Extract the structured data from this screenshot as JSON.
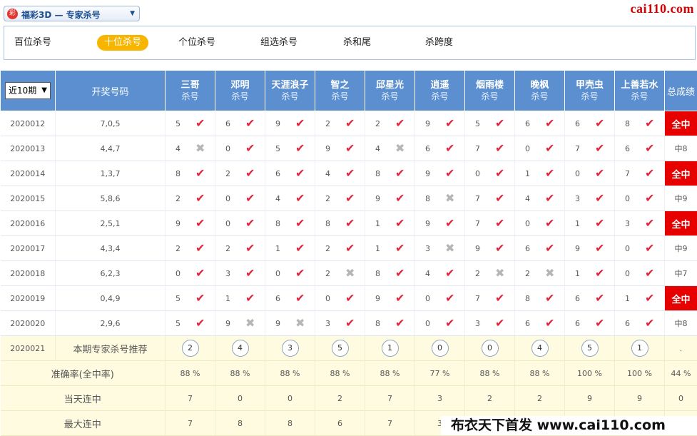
{
  "header": {
    "selector_logo": "彩",
    "selector_text": "福彩3D — 专家杀号",
    "brand": "cai110.com"
  },
  "tabs": [
    {
      "label": "百位杀号",
      "active": false
    },
    {
      "label": "十位杀号",
      "active": true
    },
    {
      "label": "个位杀号",
      "active": false
    },
    {
      "label": "组选杀号",
      "active": false
    },
    {
      "label": "杀和尾",
      "active": false
    },
    {
      "label": "杀跨度",
      "active": false
    }
  ],
  "table": {
    "period_select": "近10期",
    "draw_header": "开奖号码",
    "total_header": "总成绩",
    "sub_label": "杀号",
    "experts": [
      "三哥",
      "邓明",
      "天涯浪子",
      "智之",
      "邱星光",
      "逍遥",
      "烟雨楼",
      "晚枫",
      "甲壳虫",
      "上善若水"
    ],
    "rows": [
      {
        "issue": "2020012",
        "draw": "7,0,5",
        "kills": [
          5,
          6,
          9,
          2,
          2,
          9,
          5,
          6,
          6,
          8
        ],
        "hit": [
          1,
          1,
          1,
          1,
          1,
          1,
          1,
          1,
          1,
          1
        ],
        "total": "全中",
        "all": true
      },
      {
        "issue": "2020013",
        "draw": "4,4,7",
        "kills": [
          4,
          0,
          5,
          9,
          4,
          6,
          7,
          0,
          7,
          6
        ],
        "hit": [
          0,
          1,
          1,
          1,
          0,
          1,
          1,
          1,
          1,
          1
        ],
        "total": "中8",
        "all": false
      },
      {
        "issue": "2020014",
        "draw": "1,3,7",
        "kills": [
          8,
          2,
          6,
          4,
          8,
          9,
          0,
          1,
          0,
          7
        ],
        "hit": [
          1,
          1,
          1,
          1,
          1,
          1,
          1,
          1,
          1,
          1
        ],
        "total": "全中",
        "all": true
      },
      {
        "issue": "2020015",
        "draw": "5,8,6",
        "kills": [
          2,
          0,
          4,
          2,
          9,
          8,
          7,
          4,
          3,
          0
        ],
        "hit": [
          1,
          1,
          1,
          1,
          1,
          0,
          1,
          1,
          1,
          1
        ],
        "total": "中9",
        "all": false
      },
      {
        "issue": "2020016",
        "draw": "2,5,1",
        "kills": [
          9,
          0,
          8,
          8,
          1,
          9,
          7,
          0,
          1,
          3
        ],
        "hit": [
          1,
          1,
          1,
          1,
          1,
          1,
          1,
          1,
          1,
          1
        ],
        "total": "全中",
        "all": true
      },
      {
        "issue": "2020017",
        "draw": "4,3,4",
        "kills": [
          2,
          2,
          1,
          2,
          1,
          3,
          9,
          6,
          9,
          0
        ],
        "hit": [
          1,
          1,
          1,
          1,
          1,
          0,
          1,
          1,
          1,
          1
        ],
        "total": "中9",
        "all": false
      },
      {
        "issue": "2020018",
        "draw": "6,2,3",
        "kills": [
          0,
          3,
          0,
          2,
          8,
          4,
          2,
          2,
          1,
          0
        ],
        "hit": [
          1,
          1,
          1,
          0,
          1,
          1,
          0,
          0,
          1,
          1
        ],
        "total": "中7",
        "all": false
      },
      {
        "issue": "2020019",
        "draw": "0,4,9",
        "kills": [
          5,
          1,
          6,
          0,
          9,
          0,
          7,
          8,
          6,
          1
        ],
        "hit": [
          1,
          1,
          1,
          1,
          1,
          1,
          1,
          1,
          1,
          1
        ],
        "total": "全中",
        "all": true
      },
      {
        "issue": "2020020",
        "draw": "2,9,6",
        "kills": [
          5,
          9,
          9,
          3,
          8,
          0,
          3,
          6,
          6,
          6
        ],
        "hit": [
          1,
          0,
          0,
          1,
          1,
          1,
          1,
          1,
          1,
          1
        ],
        "total": "中8",
        "all": false
      }
    ],
    "recommend": {
      "issue": "2020021",
      "label": "本期专家杀号推荐",
      "values": [
        2,
        4,
        3,
        5,
        1,
        0,
        0,
        4,
        5,
        1
      ],
      "total": "."
    },
    "accuracy": {
      "label": "准确率(全中率)",
      "values": [
        "88 %",
        "88 %",
        "88 %",
        "88 %",
        "88 %",
        "77 %",
        "88 %",
        "88 %",
        "100 %",
        "100 %"
      ],
      "total": "44 %"
    },
    "today_streak": {
      "label": "当天连中",
      "values": [
        "7",
        "0",
        "0",
        "2",
        "7",
        "3",
        "2",
        "2",
        "9",
        "9"
      ],
      "total": "0"
    },
    "max_streak": {
      "label": "最大连中",
      "values": [
        "7",
        "8",
        "8",
        "6",
        "7",
        "3",
        "",
        "",
        "",
        ""
      ],
      "total": ""
    }
  },
  "watermark": "布衣天下首发 www.cai110.com",
  "icons": {
    "hit": "check-icon",
    "miss": "cross-icon"
  },
  "colors": {
    "header_blue": "#5b8fd0",
    "hit_red": "#e2233b",
    "all_hit_bg": "#e60000",
    "tab_active": "#f7b500",
    "yellow_row": "#fffbe0"
  }
}
